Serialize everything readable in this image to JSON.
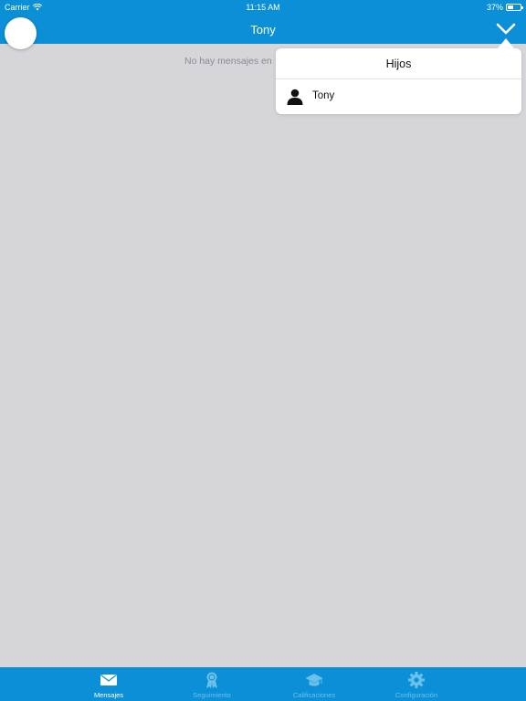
{
  "status_bar": {
    "carrier": "Carrier",
    "time": "11:15 AM",
    "battery": "37%"
  },
  "nav": {
    "title": "Tony"
  },
  "main": {
    "empty_message": "No hay mensajes en"
  },
  "popover": {
    "title": "Hijos",
    "items": [
      {
        "label": "Tony",
        "icon": "user-icon"
      }
    ]
  },
  "tabbar": {
    "tabs": [
      {
        "label": "Mensajes",
        "icon": "envelope-icon",
        "active": true
      },
      {
        "label": "Seguimiento",
        "icon": "award-ribbon-icon",
        "active": false
      },
      {
        "label": "Calificaciones",
        "icon": "graduation-cap-icon",
        "active": false
      },
      {
        "label": "Configuración",
        "icon": "gear-icon",
        "active": false
      }
    ]
  },
  "colors": {
    "primary_blue": "#0b8fd6",
    "background": "#d5d5da",
    "inactive_tab": "#6cc1ec"
  }
}
